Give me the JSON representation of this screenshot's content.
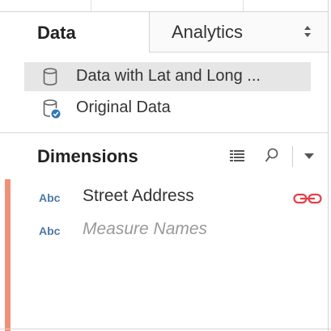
{
  "tabs": {
    "data": "Data",
    "analytics": "Analytics"
  },
  "data_sources": [
    {
      "label": "Data with Lat and Long ...",
      "icon": "database-icon",
      "selected": true
    },
    {
      "label": "Original Data",
      "icon": "database-extract-icon",
      "selected": false
    }
  ],
  "dimensions": {
    "title": "Dimensions",
    "fields": [
      {
        "type_badge": "Abc",
        "name": "Street Address",
        "linked": true
      },
      {
        "type_badge": "Abc",
        "name": "Measure Names",
        "linked": false
      }
    ]
  },
  "colors": {
    "accent_bar": "#f0917a",
    "link_icon": "#e2414b",
    "type_badge": "#4e79a7",
    "extract_badge": "#2f77b8",
    "selection": "#e6e6e6"
  }
}
